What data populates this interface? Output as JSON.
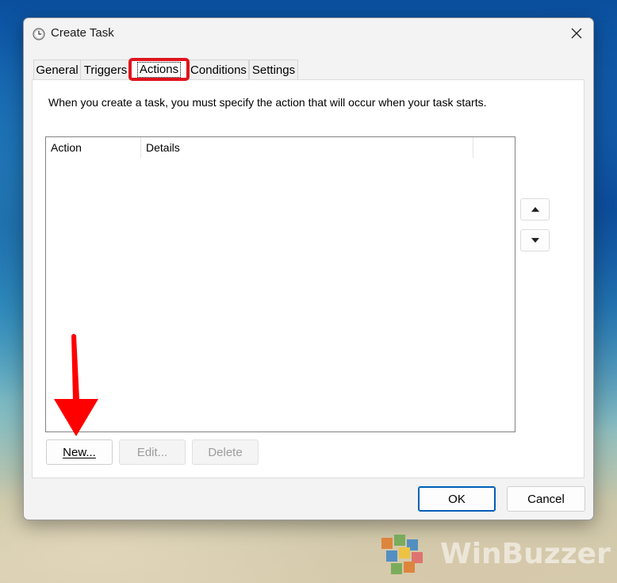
{
  "window": {
    "title": "Create Task"
  },
  "tabs": [
    {
      "label": "General",
      "active": false
    },
    {
      "label": "Triggers",
      "active": false
    },
    {
      "label": "Actions",
      "active": true
    },
    {
      "label": "Conditions",
      "active": false
    },
    {
      "label": "Settings",
      "active": false
    }
  ],
  "actions": {
    "instruction": "When you create a task, you must specify the action that will occur when your task starts.",
    "columns": [
      "Action",
      "Details"
    ],
    "rows": [],
    "buttons": {
      "new_label": "New...",
      "edit_label": "Edit...",
      "delete_label": "Delete"
    }
  },
  "footer": {
    "ok_label": "OK",
    "cancel_label": "Cancel"
  },
  "watermark": {
    "text": "WinBuzzer"
  },
  "colors": {
    "highlight": "#e0141e",
    "arrow": "#ff0000",
    "primary_border": "#005fb8"
  },
  "icons": {
    "title": "clock-icon",
    "close": "close-icon",
    "move_up": "triangle-up-icon",
    "move_down": "triangle-down-icon"
  }
}
